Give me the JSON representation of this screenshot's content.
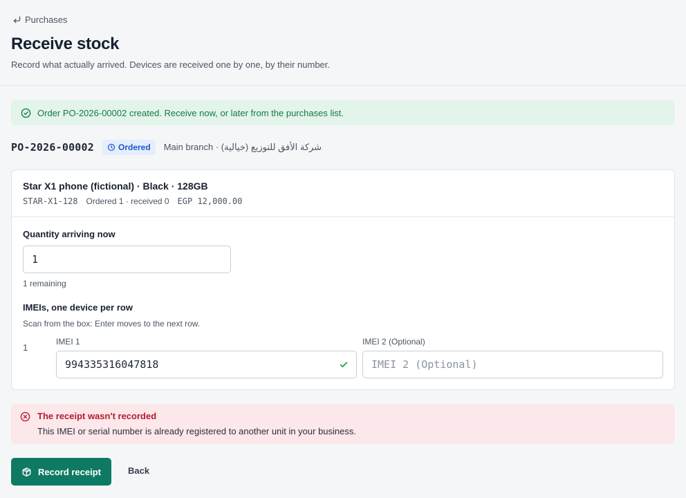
{
  "breadcrumb": {
    "back_label": "Purchases",
    "icon": "return-arrow-icon"
  },
  "header": {
    "title": "Receive stock",
    "subtitle": "Record what actually arrived. Devices are received one by one, by their number."
  },
  "success_banner": {
    "text": "Order PO-2026-00002 created. Receive now, or later from the purchases list.",
    "icon": "check-circle-icon",
    "color": "#137a48"
  },
  "order": {
    "number": "PO-2026-00002",
    "status": "Ordered",
    "status_icon": "clock-icon",
    "supplier_branch": "شركة الأفق للتوزيع (خيالية) · Main branch"
  },
  "product": {
    "name": "Star X1 phone (fictional) · Black · 128GB",
    "sku": "STAR-X1-128",
    "ordered_received": "Ordered 1 · received 0",
    "price": "EGP 12,000.00"
  },
  "quantity": {
    "label": "Quantity arriving now",
    "value": "1",
    "remaining": "1 remaining"
  },
  "imeis": {
    "label": "IMEIs, one device per row",
    "hint": "Scan from the box: Enter moves to the next row.",
    "rows": [
      {
        "num": "1",
        "imei1_label": "IMEI 1",
        "imei1_value": "994335316047818",
        "imei2_label": "IMEI 2 (Optional)",
        "imei2_placeholder": "IMEI 2 (Optional)"
      }
    ]
  },
  "error_banner": {
    "title": "The receipt wasn't recorded",
    "text": "This IMEI or serial number is already registered to another unit in your business.",
    "icon": "x-circle-icon",
    "color": "#b41c2d"
  },
  "actions": {
    "primary_label": "Record receipt",
    "primary_icon": "package-icon",
    "back_label": "Back"
  },
  "colors": {
    "accent": "#0f7a63",
    "badge_bg": "#e4eefc",
    "badge_text": "#1d57c8"
  }
}
